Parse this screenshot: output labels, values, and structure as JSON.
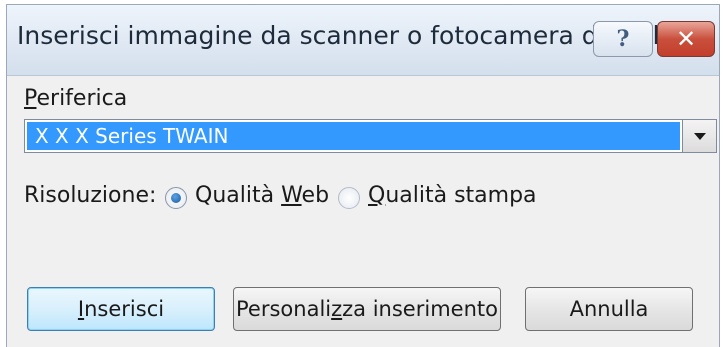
{
  "window": {
    "title": "Inserisci immagine da scanner o fotocamera digitale",
    "help_glyph": "?",
    "close_glyph": "✕"
  },
  "device": {
    "label_mnemonic": "P",
    "label_rest": "eriferica",
    "selected": "X X X Series TWAIN"
  },
  "resolution": {
    "label": "Risoluzione:",
    "options": [
      {
        "pre": "Qualità ",
        "mnemonic": "W",
        "post": "eb",
        "selected": true
      },
      {
        "pre": "",
        "mnemonic": "Q",
        "post": "ualità stampa",
        "selected": false
      }
    ]
  },
  "buttons": {
    "insert": {
      "mnemonic": "I",
      "rest": "nserisci"
    },
    "custom": {
      "pre": "Personali",
      "mnemonic": "z",
      "post": "za inserimento"
    },
    "cancel": {
      "label": "Annulla"
    }
  },
  "colors": {
    "selection": "#3399ff",
    "close_button": "#c9503d",
    "dialog_background": "#f0f0f0"
  }
}
